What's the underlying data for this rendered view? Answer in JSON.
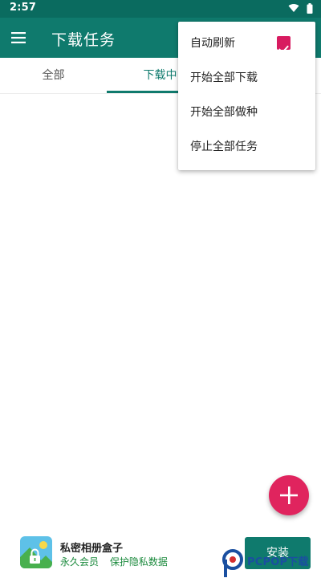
{
  "status_bar": {
    "time": "2:57",
    "icons": [
      "wifi-icon",
      "battery-icon"
    ]
  },
  "app_bar": {
    "title": "下载任务",
    "menu_icon": "menu-icon",
    "background_color": "#0f7a6d"
  },
  "tabs": [
    {
      "label": "全部",
      "active": false
    },
    {
      "label": "下载中",
      "active": true
    }
  ],
  "popup_menu": {
    "items": [
      {
        "label": "自动刷新",
        "checked": true
      },
      {
        "label": "开始全部下载"
      },
      {
        "label": "开始全部做种"
      },
      {
        "label": "停止全部任务"
      }
    ],
    "checkbox_color": "#d81b60"
  },
  "fab": {
    "icon": "plus-icon",
    "color": "#e0245e"
  },
  "ad": {
    "icon": "photo-lock-icon",
    "title": "私密相册盒子",
    "subtitle_1": "永久会员",
    "subtitle_2": "保护隐私数据",
    "install_label": "安装"
  },
  "watermark": {
    "text": "PCPOP下载"
  }
}
